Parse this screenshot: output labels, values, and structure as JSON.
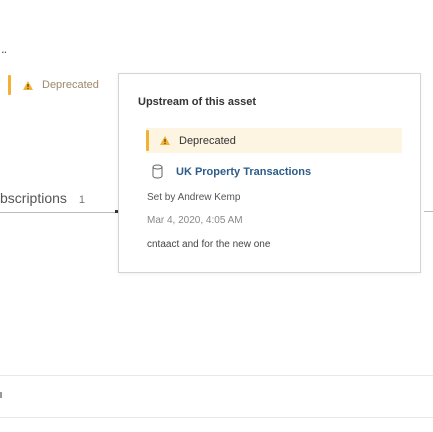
{
  "background": {
    "menu_dots": "..",
    "deprecated_badge": {
      "label": "Deprecated",
      "icon": "warning-icon"
    },
    "subscriptions_tab": {
      "label": "bscriptions",
      "count": "1"
    }
  },
  "popover": {
    "title": "Upstream of this asset",
    "badge": {
      "label": "Deprecated",
      "icon": "warning-icon"
    },
    "asset": {
      "icon": "database-icon",
      "name": "UK Property Transactions"
    },
    "set_by": "Set by Andrew Kemp",
    "date": "Mar 4, 2020, 4:05 AM",
    "note": "cntaact and for the new one"
  },
  "colors": {
    "deprecated_bar": "#f2b134",
    "deprecated_bg": "#fdf5e2",
    "link": "#2c5c8a"
  }
}
